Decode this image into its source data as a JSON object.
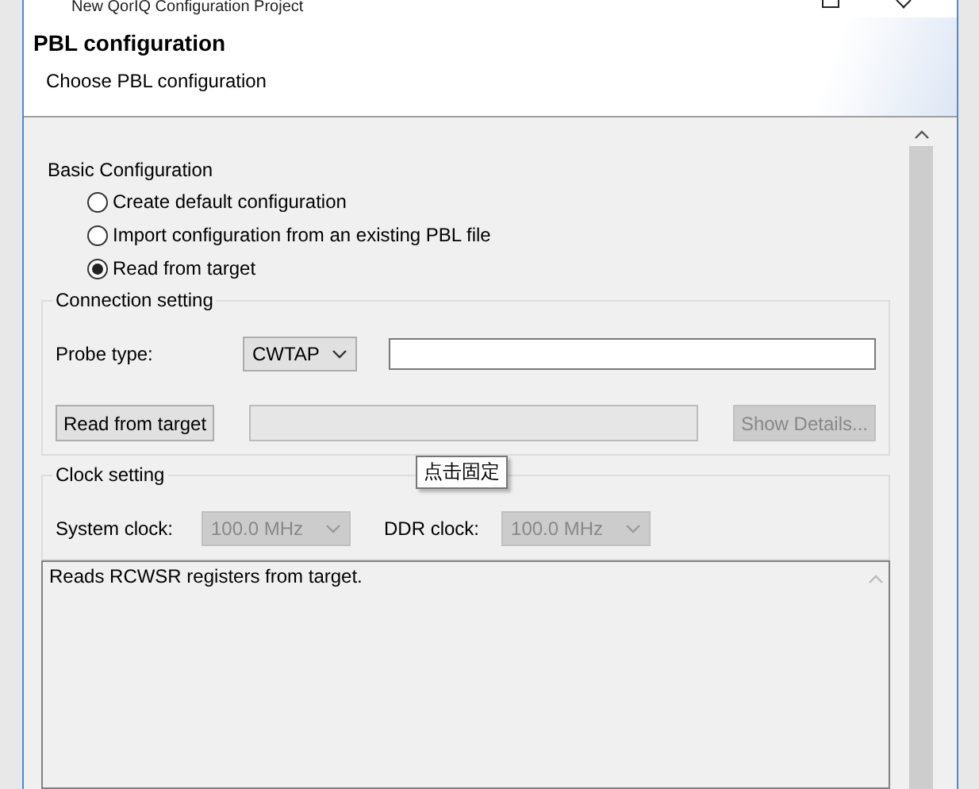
{
  "window": {
    "title": "New QorIQ Configuration Project"
  },
  "header": {
    "title": "PBL configuration",
    "description": "Choose PBL configuration"
  },
  "basic": {
    "label": "Basic Configuration",
    "options": [
      {
        "label": "Create default configuration",
        "selected": false
      },
      {
        "label": "Import configuration from an existing PBL file",
        "selected": false
      },
      {
        "label": "Read from target",
        "selected": true
      }
    ]
  },
  "connection": {
    "legend": "Connection setting",
    "probe_label": "Probe type:",
    "probe_value": "CWTAP",
    "read_button": "Read from target",
    "progress": {
      "level": 0
    },
    "details_button": {
      "label": "Show Details...",
      "disabled": true
    }
  },
  "clock": {
    "legend": "Clock setting",
    "fields": [
      {
        "label": "System clock:",
        "value": "100.0 MHz",
        "disabled": true
      },
      {
        "label": "DDR clock:",
        "value": "100.0 MHz",
        "disabled": true
      }
    ]
  },
  "description_box": {
    "text": "Reads RCWSR registers from target."
  },
  "tooltip": {
    "text": "点击固定"
  }
}
